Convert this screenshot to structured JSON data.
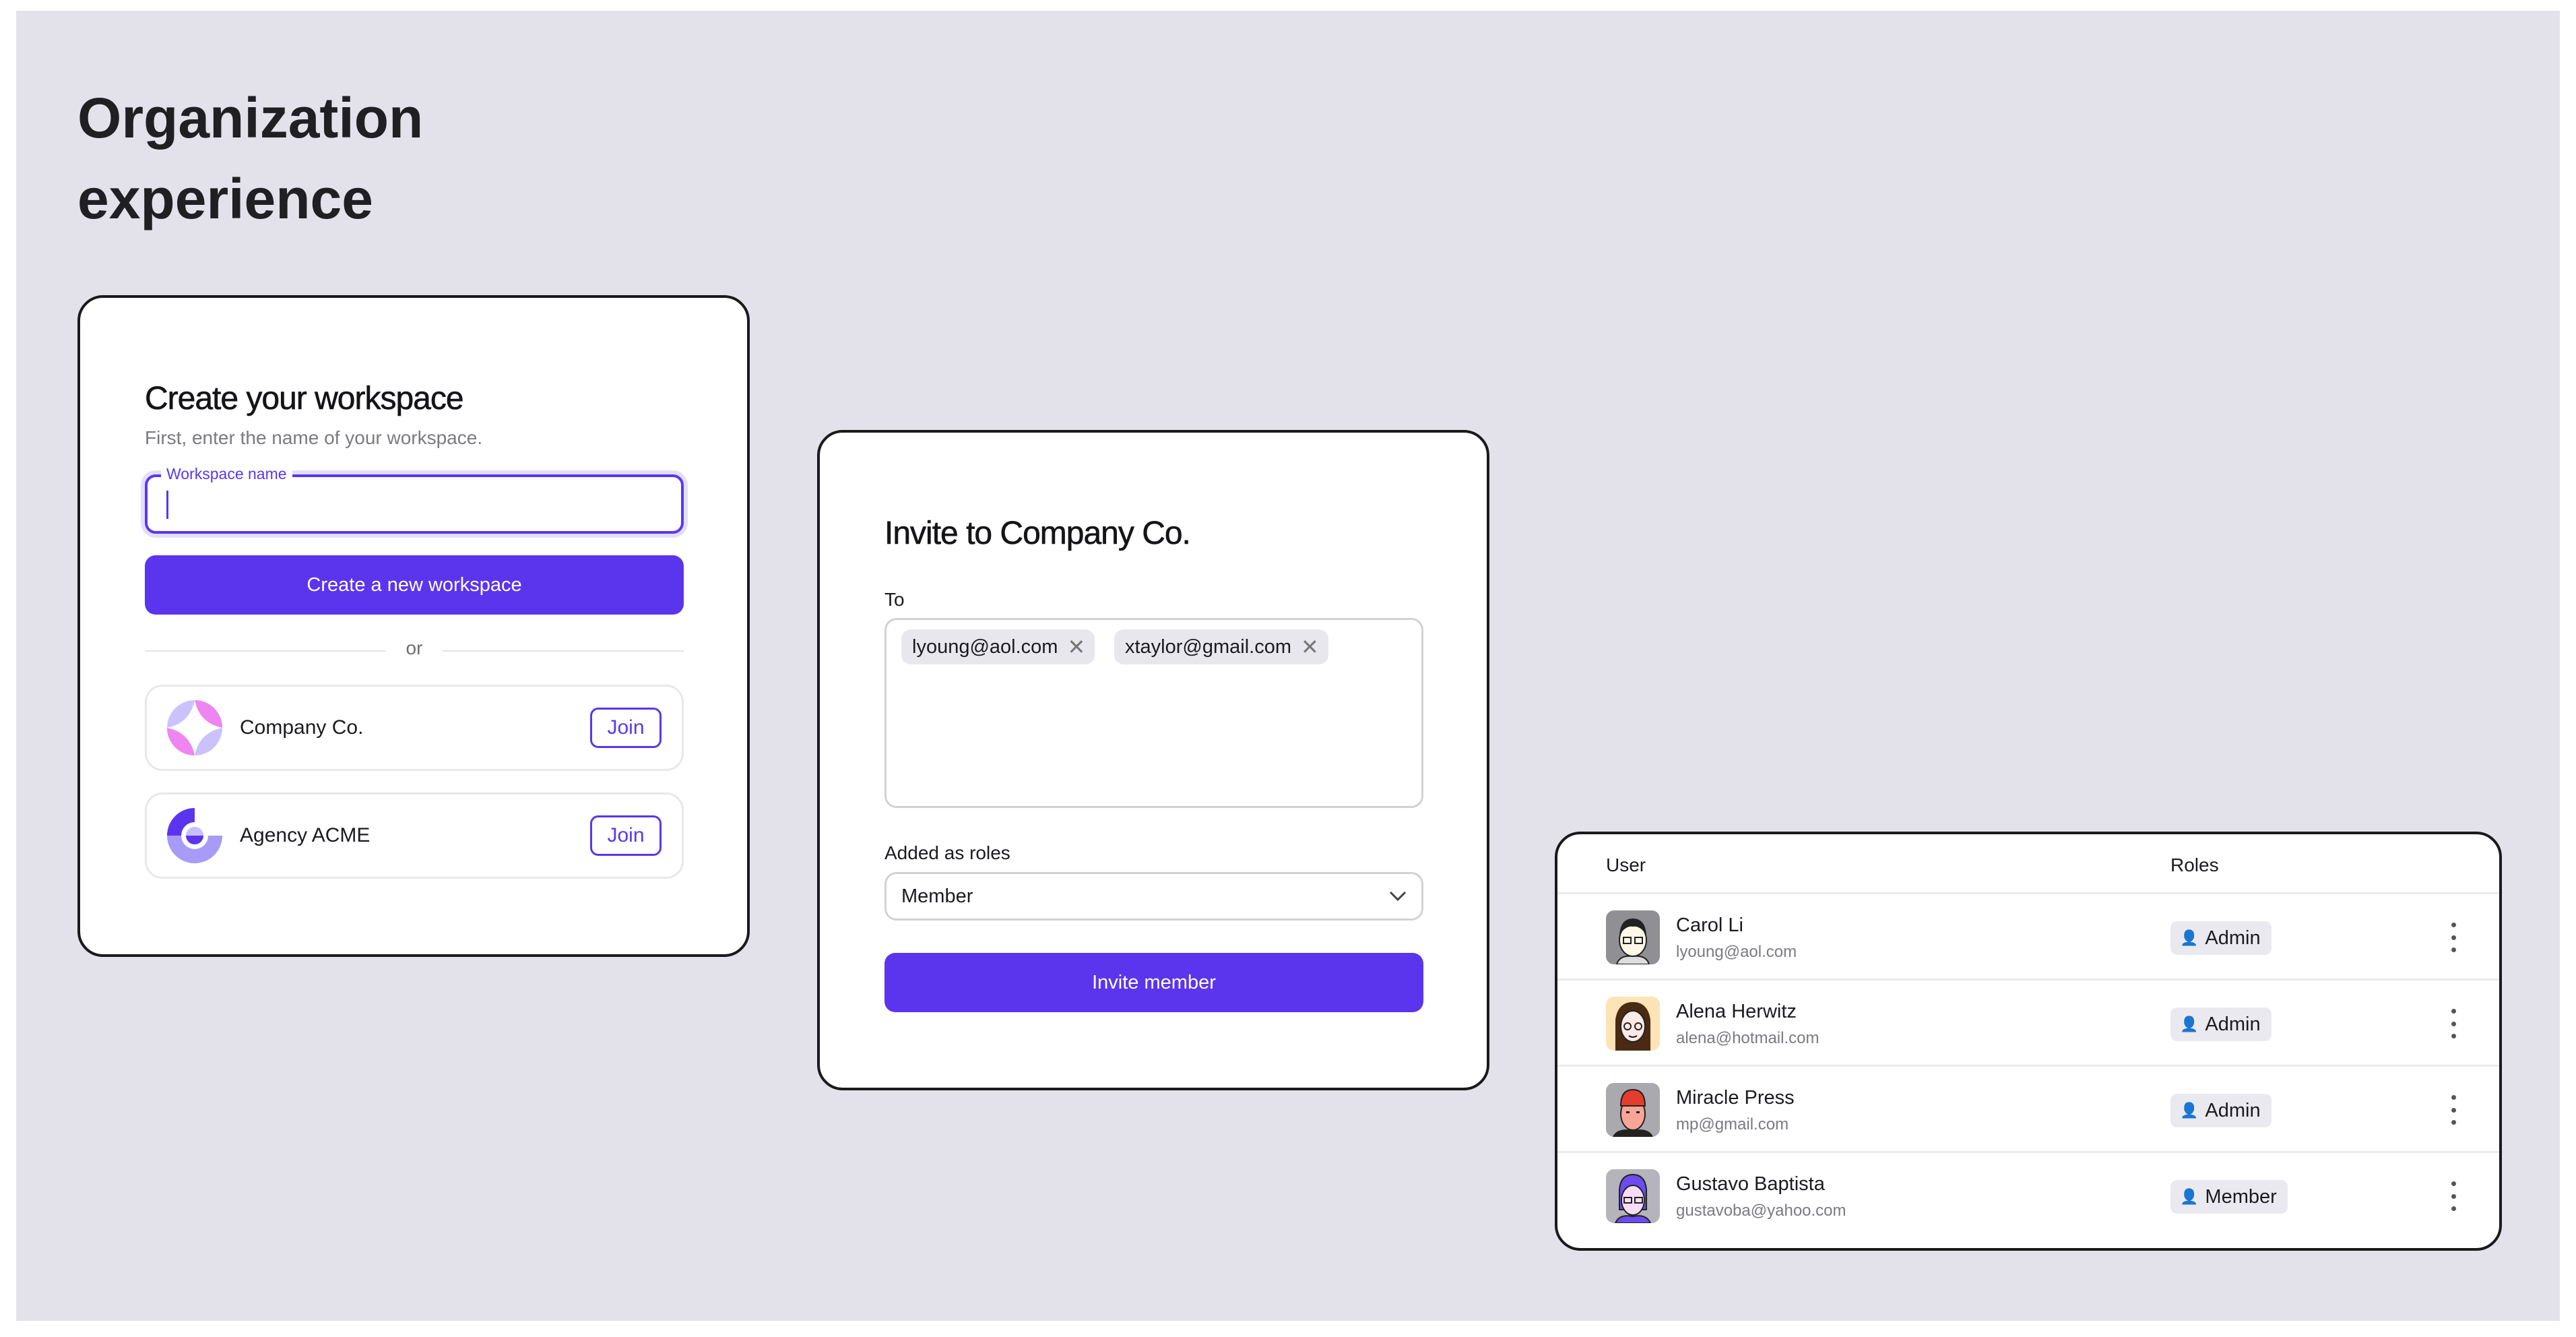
{
  "page_title": [
    "Organization",
    "experience"
  ],
  "create_workspace": {
    "heading": "Create your workspace",
    "subtitle": "First, enter the name of your workspace.",
    "field_label": "Workspace name",
    "field_value": "",
    "create_button": "Create a new workspace",
    "divider_text": "or",
    "workspaces": [
      {
        "name": "Company Co.",
        "icon": "company-co-logo",
        "action": "Join"
      },
      {
        "name": "Agency ACME",
        "icon": "agency-acme-logo",
        "action": "Join"
      }
    ]
  },
  "invite": {
    "heading": "Invite to Company Co.",
    "to_label": "To",
    "recipients": [
      "lyoung@aol.com",
      "xtaylor@gmail.com"
    ],
    "roles_label": "Added as roles",
    "role_selected": "Member",
    "invite_button": "Invite member"
  },
  "users_table": {
    "columns": [
      "User",
      "Roles"
    ],
    "rows": [
      {
        "name": "Carol Li",
        "email": "lyoung@aol.com",
        "role": "Admin"
      },
      {
        "name": "Alena Herwitz",
        "email": "alena@hotmail.com",
        "role": "Admin"
      },
      {
        "name": "Miracle Press",
        "email": "mp@gmail.com",
        "role": "Admin"
      },
      {
        "name": "Gustavo Baptista",
        "email": "gustavoba@yahoo.com",
        "role": "Member"
      }
    ]
  },
  "colors": {
    "accent": "#5b35ee",
    "background": "#e3e1ea",
    "badge": "#ebe9f0"
  }
}
